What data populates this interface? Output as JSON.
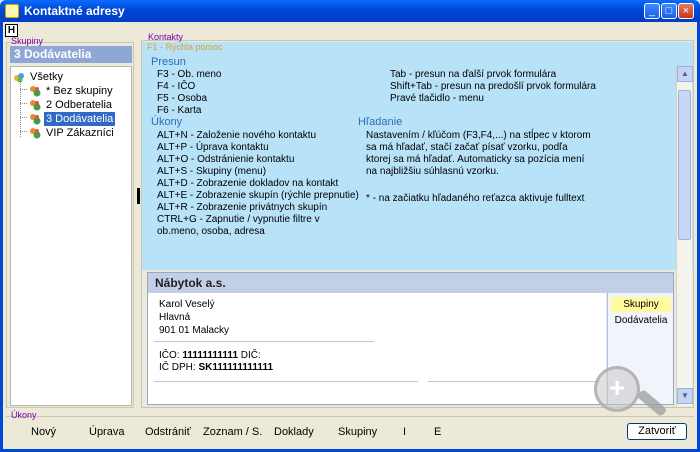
{
  "window": {
    "title": "Kontaktné adresy"
  },
  "toolbar": {
    "help_button": "H"
  },
  "groups": {
    "title": "Skupiny",
    "selected_header": "3 Dodávatelia",
    "tree": [
      {
        "label": "Všetky",
        "level": 0,
        "selected": false
      },
      {
        "label": "* Bez skupiny",
        "level": 1,
        "selected": false
      },
      {
        "label": "2 Odberatelia",
        "level": 1,
        "selected": false
      },
      {
        "label": "3 Dodávatelia",
        "level": 1,
        "selected": true
      },
      {
        "label": "VIP Zákazníci",
        "level": 1,
        "selected": false
      }
    ]
  },
  "contacts": {
    "title": "Kontakty",
    "help": {
      "title": "F1 - Rýchla pomoc",
      "section_presun": "Presun",
      "presun_left": [
        "F3 - Ob. meno",
        "F4 - IČO",
        "F5 - Osoba",
        "F6 - Karta"
      ],
      "presun_right": [
        "Tab - presun na ďalší prvok formulára",
        "Shift+Tab - presun na predošlí prvok formulára",
        "Pravé tlačidlo - menu"
      ],
      "section_ukony": "Úkony",
      "ukony": [
        "ALT+N - Založenie nového kontaktu",
        "ALT+P - Úprava kontaktu",
        "ALT+O - Odstránienie kontaktu",
        "ALT+S - Skupiny (menu)",
        "ALT+D - Zobrazenie dokladov na kontakt",
        "ALT+E - Zobrazenie skupín (rýchle prepnutie)",
        "ALT+R - Zobrazenie privátnych skupín",
        "CTRL+G - Zapnutie / vypnutie filtre v",
        "ob.meno, osoba, adresa"
      ],
      "section_hladanie": "Hľadanie",
      "hladanie": [
        "Nastavením / kľúčom (F3,F4,...) na stĺpec v ktorom",
        "sa má hľadať, stačí začať písať vzorku, podľa",
        "ktorej sa má hľadať. Automaticky sa pozícia mení",
        "na najbližšiu súhlasnú vzorku."
      ],
      "fulltext_note": "* - na začiatku hľadaného reťazca aktivuje fulltext"
    },
    "card": {
      "company": "Nábytok a.s.",
      "person": "Karol Veselý",
      "street": "Hlavná",
      "city": "901 01 Malacky",
      "ico_label": "IČO:",
      "ico_value": "11111111111",
      "dic_label": "DIČ:",
      "icdph_label": "IČ DPH:",
      "icdph_value": "SK111111111111",
      "groups_label": "Skupiny",
      "group_value": "Dodávatelia"
    }
  },
  "actions": {
    "title": "Úkony",
    "items": [
      "Nový",
      "Úprava",
      "Odstrániť",
      "Zoznam / S.",
      "Doklady",
      "Skupiny",
      "I",
      "E"
    ],
    "close_button": "Zatvoriť"
  },
  "icons": {
    "title_icon": "contacts-icon",
    "tree_icons": [
      "folder-group-icon",
      "group-icon",
      "group-icon",
      "group-icon",
      "group-icon"
    ],
    "zoom_icon": "zoom-in-icon"
  },
  "colors": {
    "titlebar": "#0047d6",
    "help_background": "#b8e2f8",
    "selection": "#316ac5",
    "card_header": "#c3cfe6",
    "highlight_yellow": "#fffa9d",
    "group_title": "#7b00b3",
    "help_section": "#2c6db8"
  }
}
